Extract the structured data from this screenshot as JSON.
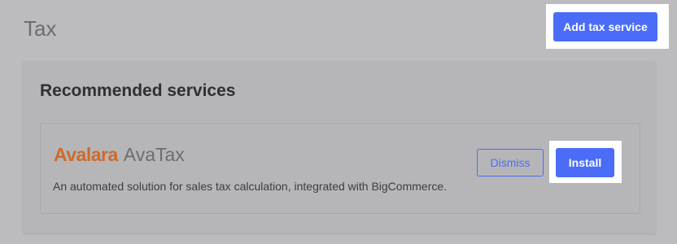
{
  "header": {
    "title": "Tax",
    "add_button_label": "Add tax service"
  },
  "recommended": {
    "heading": "Recommended services",
    "services": [
      {
        "brand": "Avalara",
        "product": "AvaTax",
        "description": "An automated solution for sales tax calculation, integrated with BigCommerce.",
        "dismiss_label": "Dismiss",
        "install_label": "Install"
      }
    ]
  },
  "colors": {
    "primary": "#4a6cf7",
    "avalara_brand": "#cf6a2a",
    "backdrop": "#bcbcbe"
  }
}
